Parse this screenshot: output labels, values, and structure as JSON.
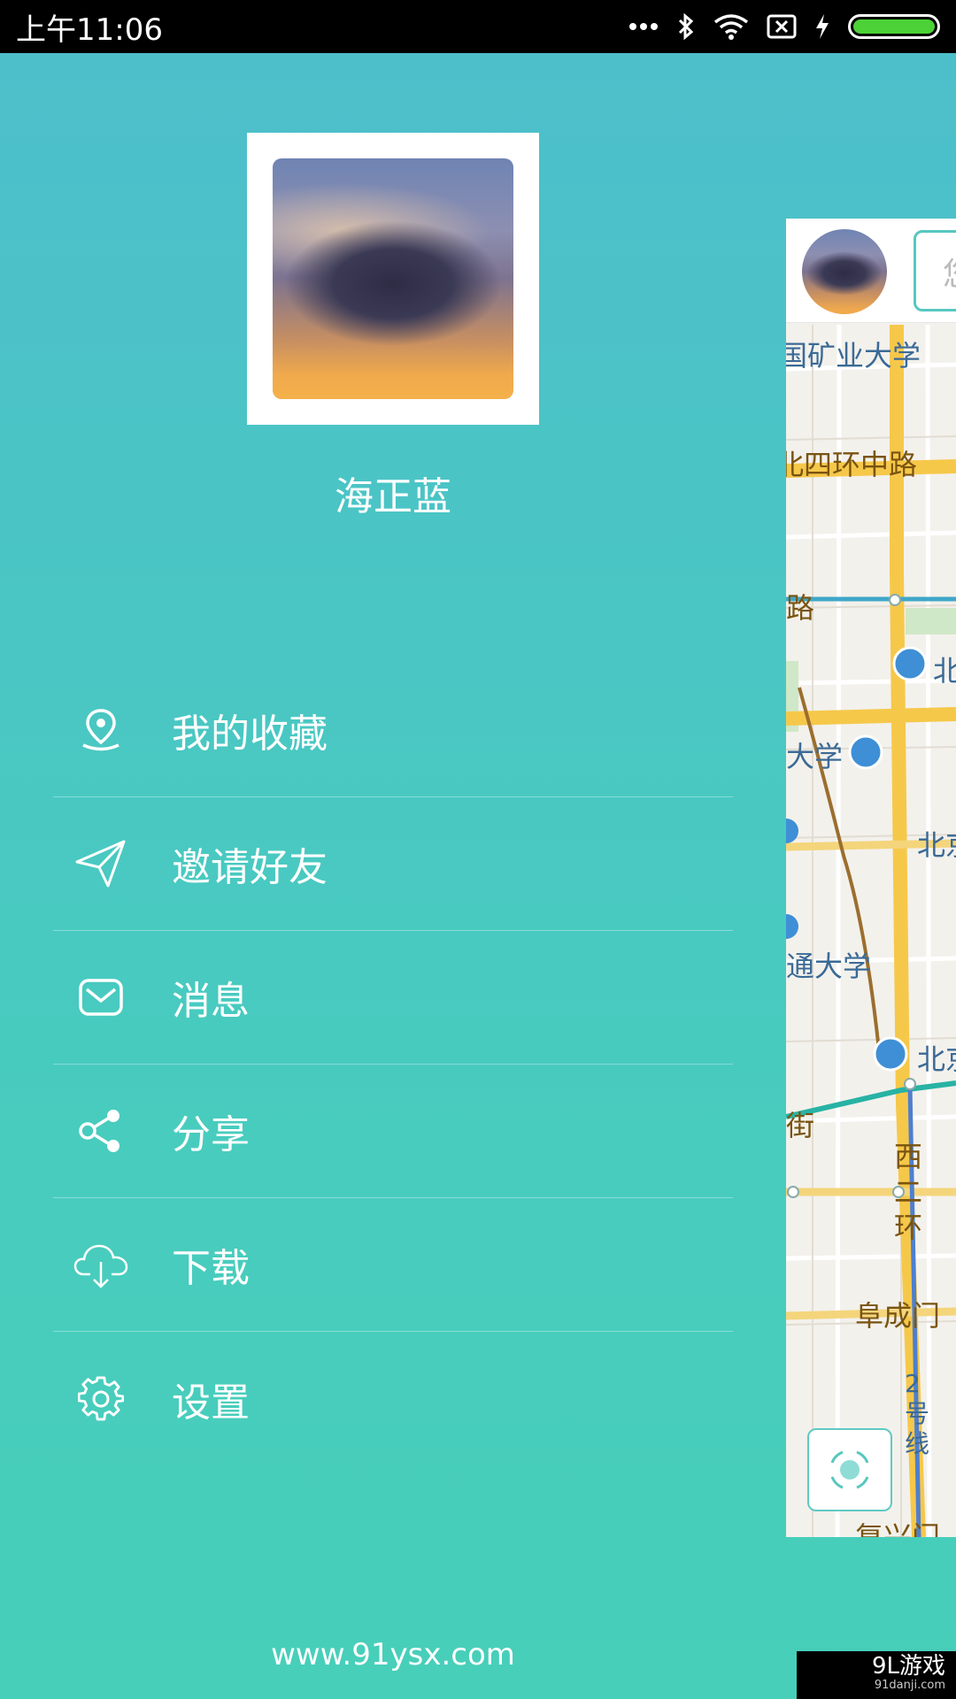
{
  "status_bar": {
    "time": "上午11:06",
    "icons": [
      "more-dots-icon",
      "bluetooth-icon",
      "wifi-icon",
      "sim-x-icon",
      "charging-icon",
      "battery-icon"
    ]
  },
  "profile": {
    "name": "海正蓝"
  },
  "menu": {
    "items": [
      {
        "label": "我的收藏",
        "icon": "location-pin-icon"
      },
      {
        "label": "邀请好友",
        "icon": "send-icon"
      },
      {
        "label": "消息",
        "icon": "mail-icon"
      },
      {
        "label": "分享",
        "icon": "share-icon"
      },
      {
        "label": "下载",
        "icon": "cloud-download-icon"
      },
      {
        "label": "设置",
        "icon": "gear-icon"
      }
    ]
  },
  "footer": {
    "url": "www.91ysx.com"
  },
  "map": {
    "search_placeholder": "您",
    "labels": [
      "国矿业大学",
      "北四环中路",
      "路",
      "北",
      "大学",
      "北京",
      "通大学",
      "北京",
      "街",
      "西二环",
      "阜成门",
      "2号线",
      "复兴门"
    ]
  },
  "watermark": {
    "brand": "9L游戏",
    "site": "91danji.com"
  },
  "colors": {
    "drawer_top": "#4dbfcb",
    "drawer_bottom": "#47cfb9",
    "accent": "#57c7c0"
  }
}
